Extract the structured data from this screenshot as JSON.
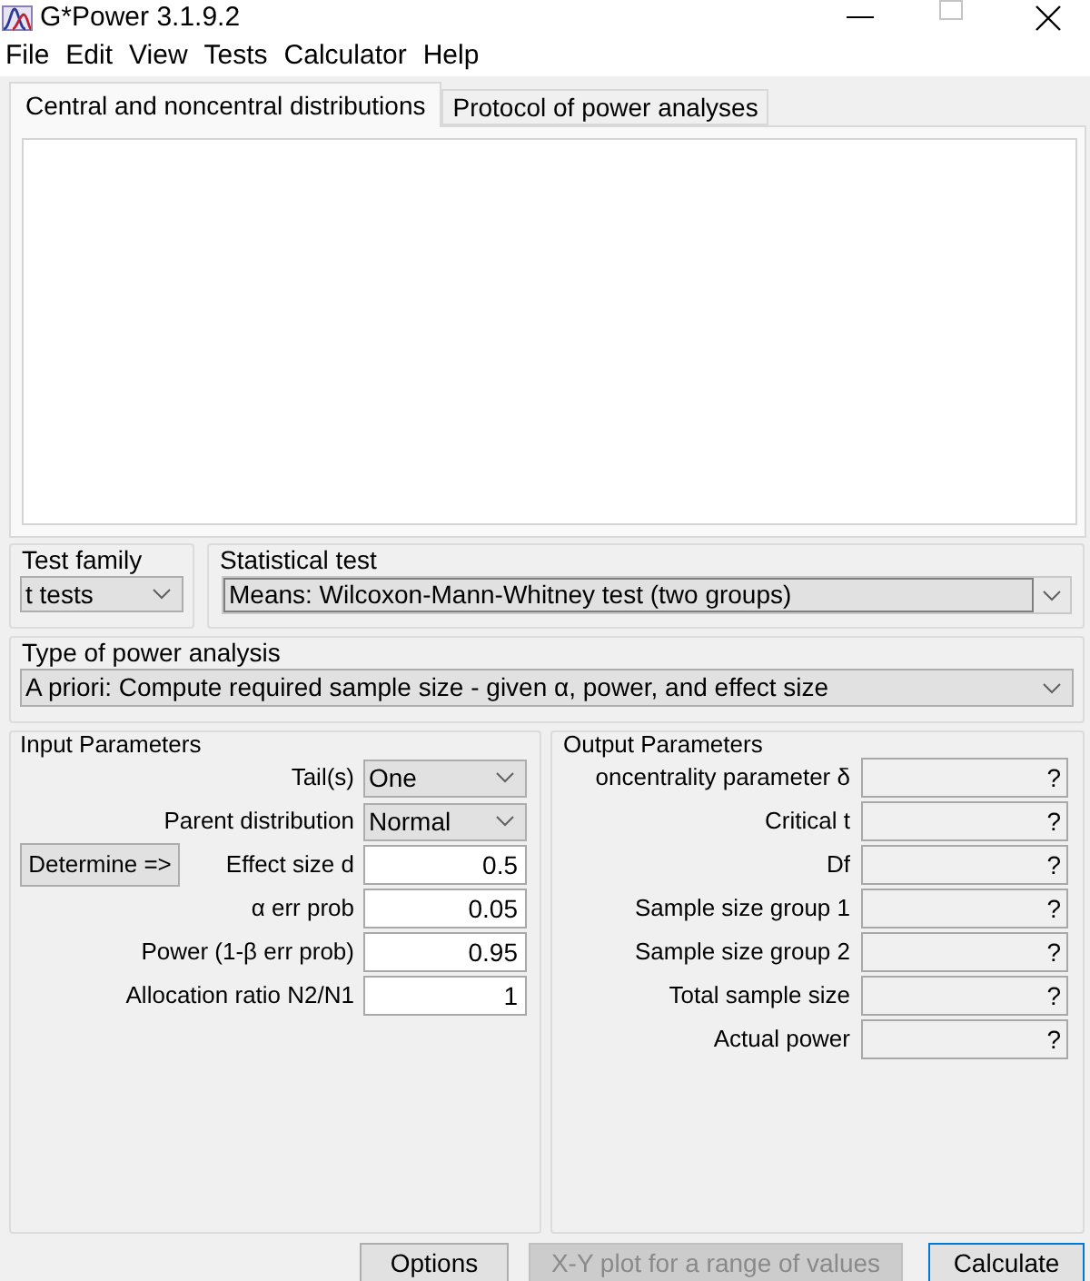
{
  "window": {
    "title": "G*Power 3.1.9.2"
  },
  "menu": [
    "File",
    "Edit",
    "View",
    "Tests",
    "Calculator",
    "Help"
  ],
  "tabs": [
    {
      "label": "Central and noncentral distributions",
      "selected": true
    },
    {
      "label": "Protocol of power analyses",
      "selected": false
    }
  ],
  "test_family": {
    "label": "Test family",
    "value": "t tests"
  },
  "statistical_test": {
    "label": "Statistical test",
    "value": "Means: Wilcoxon-Mann-Whitney test (two groups)"
  },
  "power_analysis_type": {
    "label": "Type of power analysis",
    "value": "A priori: Compute required sample size - given α, power, and effect size"
  },
  "input_parameters": {
    "title": "Input Parameters",
    "rows": [
      {
        "label": "Tail(s)",
        "kind": "dropdown",
        "value": "One"
      },
      {
        "label": "Parent distribution",
        "kind": "dropdown",
        "value": "Normal"
      },
      {
        "label": "Effect size d",
        "kind": "number",
        "value": "0.5",
        "button": "Determine =>"
      },
      {
        "label": "α err prob",
        "kind": "number",
        "value": "0.05"
      },
      {
        "label": "Power (1-β err prob)",
        "kind": "number",
        "value": "0.95"
      },
      {
        "label": "Allocation ratio N2/N1",
        "kind": "number",
        "value": "1"
      }
    ]
  },
  "output_parameters": {
    "title": "Output Parameters",
    "rows": [
      {
        "label": "oncentrality parameter δ",
        "value": "?"
      },
      {
        "label": "Critical t",
        "value": "?"
      },
      {
        "label": "Df",
        "value": "?"
      },
      {
        "label": "Sample size group 1",
        "value": "?"
      },
      {
        "label": "Sample size group 2",
        "value": "?"
      },
      {
        "label": "Total sample size",
        "value": "?"
      },
      {
        "label": "Actual power",
        "value": "?"
      }
    ]
  },
  "buttons": [
    {
      "label": "Options",
      "disabled": false,
      "focused": false
    },
    {
      "label": "X-Y plot for a range of values",
      "disabled": true,
      "focused": false
    },
    {
      "label": "Calculate",
      "disabled": false,
      "focused": true
    }
  ]
}
